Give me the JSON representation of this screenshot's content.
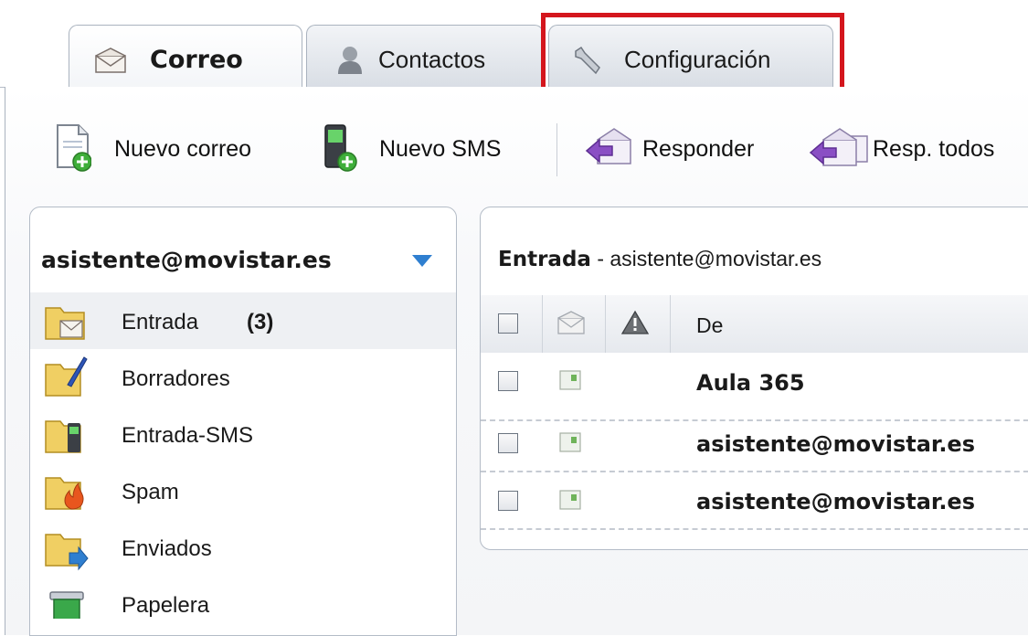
{
  "tabs": [
    {
      "label": "Correo",
      "icon": "envelope-icon",
      "active": true
    },
    {
      "label": "Contactos",
      "icon": "person-icon",
      "active": false
    },
    {
      "label": "Configuración",
      "icon": "wrench-icon",
      "active": false
    }
  ],
  "toolbar": {
    "new_mail": "Nuevo correo",
    "new_sms": "Nuevo SMS",
    "reply": "Responder",
    "reply_all": "Resp. todos"
  },
  "sidebar": {
    "account": "asistente@movistar.es",
    "folders": [
      {
        "label": "Entrada",
        "count": "(3)",
        "icon": "inbox-folder-icon"
      },
      {
        "label": "Borradores",
        "icon": "drafts-folder-icon"
      },
      {
        "label": "Entrada-SMS",
        "icon": "sms-folder-icon"
      },
      {
        "label": "Spam",
        "icon": "spam-folder-icon"
      },
      {
        "label": "Enviados",
        "icon": "sent-folder-icon"
      },
      {
        "label": "Papelera",
        "icon": "trash-icon"
      }
    ]
  },
  "list": {
    "folder": "Entrada",
    "separator": " - ",
    "account": "asistente@movistar.es",
    "header": {
      "from": "De"
    },
    "messages": [
      {
        "from": "Aula 365"
      },
      {
        "from": "asistente@movistar.es"
      },
      {
        "from": "asistente@movistar.es"
      }
    ]
  },
  "colors": {
    "highlight": "#d4161d",
    "accent": "#2f7fd0"
  }
}
